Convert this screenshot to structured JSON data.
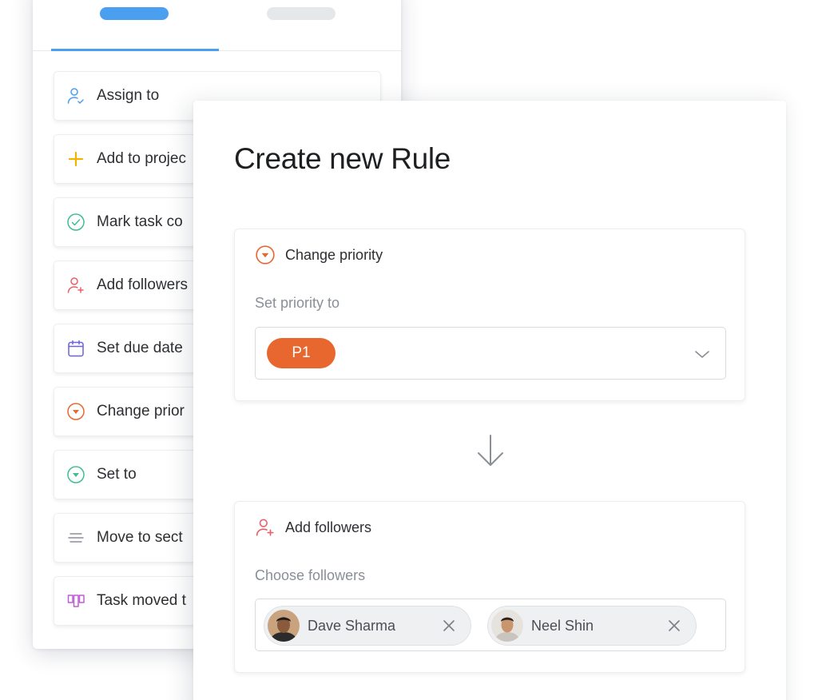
{
  "tabs": [
    {
      "label": "",
      "active": true
    },
    {
      "label": "",
      "active": false
    }
  ],
  "actions": [
    {
      "label": "Assign to",
      "icon": "assign-user-icon",
      "color": "#4a9ff0"
    },
    {
      "label": "Add to projec",
      "icon": "plus-icon",
      "color": "#f0b400"
    },
    {
      "label": "Mark task co",
      "icon": "check-circle-icon",
      "color": "#3fbf8f"
    },
    {
      "label": "Add followers",
      "icon": "add-user-icon",
      "color": "#e8606a"
    },
    {
      "label": "Set due date",
      "icon": "calendar-icon",
      "color": "#6a62d9"
    },
    {
      "label": "Change prior",
      "icon": "priority-circle-icon",
      "color": "#e8672f"
    },
    {
      "label": "Set to",
      "icon": "dropdown-circle-icon",
      "color": "#3fbf8f"
    },
    {
      "label": "Move to sect",
      "icon": "lines-icon",
      "color": "#8a8f97"
    },
    {
      "label": "Task moved t",
      "icon": "board-icon",
      "color": "#c05bd6"
    }
  ],
  "rule": {
    "title": "Create new Rule",
    "trigger": {
      "title": "Change priority",
      "icon": "priority-circle-icon",
      "subtitle": "Set priority to",
      "selected_value": "P1",
      "pill_color": "#e8672f"
    },
    "arrow_icon": "arrow-down-icon",
    "action": {
      "title": "Add followers",
      "icon": "add-user-icon",
      "subtitle": "Choose followers",
      "followers": [
        {
          "name": "Dave Sharma",
          "avatar": "avatar"
        },
        {
          "name": "Neel Shin",
          "avatar": "avatar"
        }
      ]
    }
  },
  "colors": {
    "accent": "#4a9ff0",
    "priority": "#e8672f",
    "followers_icon": "#e8606a"
  }
}
